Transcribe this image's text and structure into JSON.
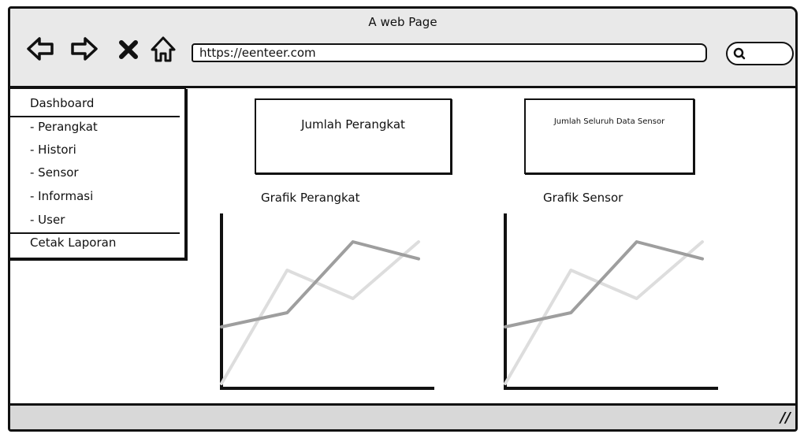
{
  "window": {
    "title": "A web Page"
  },
  "toolbar": {
    "back_icon": "arrow-left-icon",
    "forward_icon": "arrow-right-icon",
    "stop_icon": "close-icon",
    "home_icon": "home-icon",
    "url": "https://eenteer.com",
    "search_icon": "search-icon"
  },
  "sidebar": {
    "items": [
      {
        "label": "Dashboard"
      },
      {
        "label": "- Perangkat"
      },
      {
        "label": "- Histori"
      },
      {
        "label": "- Sensor"
      },
      {
        "label": "- Informasi"
      },
      {
        "label": "- User"
      },
      {
        "label": "Cetak Laporan"
      }
    ]
  },
  "main": {
    "stat_boxes": [
      {
        "label": "Jumlah Perangkat"
      },
      {
        "label": "Jumlah Seluruh Data Sensor"
      }
    ],
    "charts": [
      {
        "title": "Grafik Perangkat"
      },
      {
        "title": "Grafik Sensor"
      }
    ]
  },
  "chart_data": [
    {
      "type": "line",
      "title": "Grafik Perangkat",
      "xlabel": "",
      "ylabel": "",
      "grid": false,
      "series": [
        {
          "x": [
            0,
            1,
            2,
            3
          ],
          "values": [
            0.4,
            0.5,
            1.0,
            0.88
          ],
          "color": "#9e9e9e"
        },
        {
          "x": [
            0,
            1,
            2,
            3
          ],
          "values": [
            0.0,
            0.8,
            0.6,
            1.0
          ],
          "color": "#dddddd"
        }
      ]
    },
    {
      "type": "line",
      "title": "Grafik Sensor",
      "xlabel": "",
      "ylabel": "",
      "grid": false,
      "series": [
        {
          "x": [
            0,
            1,
            2,
            3
          ],
          "values": [
            0.4,
            0.5,
            1.0,
            0.88
          ],
          "color": "#9e9e9e"
        },
        {
          "x": [
            0,
            1,
            2,
            3
          ],
          "values": [
            0.0,
            0.8,
            0.6,
            1.0
          ],
          "color": "#dddddd"
        }
      ]
    }
  ]
}
